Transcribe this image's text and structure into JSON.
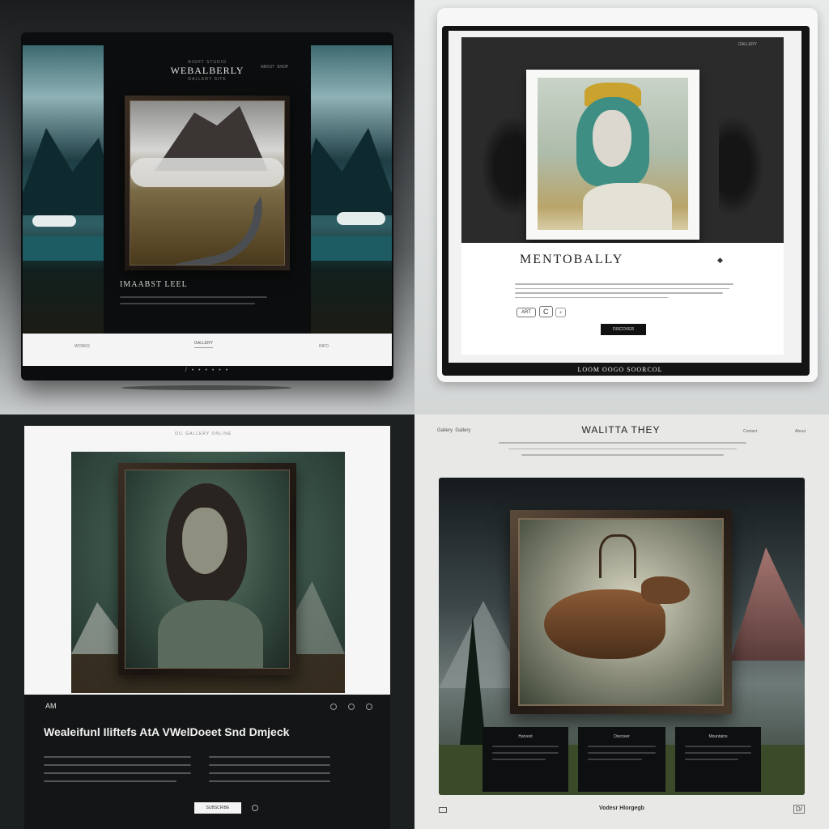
{
  "q1": {
    "brand_small": "NIGHT STUDIO",
    "title": "WEBALBERLY",
    "subtitle": "GALLERY SITE",
    "nav": [
      "ABOUT",
      "SHOP"
    ],
    "caption": "IMAABST LEEL",
    "footer_links": [
      "WORKS",
      "GALLERY",
      "INFO"
    ],
    "dots": "/ • • • • • •"
  },
  "q2": {
    "top_link": "GALLERY",
    "heading": "MENTOBALLY",
    "tags": [
      "ART",
      "C",
      "●"
    ],
    "button": "DISCOVER",
    "footer": "LOOM OOGO SOORCOL"
  },
  "q3": {
    "top_text": "OIL GALLERY ONLINE",
    "brand": "AM",
    "headline": "Wealeifunl Iliftefs AtA VWelDoeet Snd Dmjeck",
    "button": "SUBSCRIBE"
  },
  "q4": {
    "left_nav": "Gallery  Gallery",
    "title": "WALITTA THEY",
    "right_nav": [
      "Contact",
      "About"
    ],
    "cards": [
      "Harvest",
      "Discover",
      "Mountains"
    ],
    "footer_center": "Vodesr Hlorgegb",
    "footer_left": "",
    "footer_right": "D/"
  }
}
